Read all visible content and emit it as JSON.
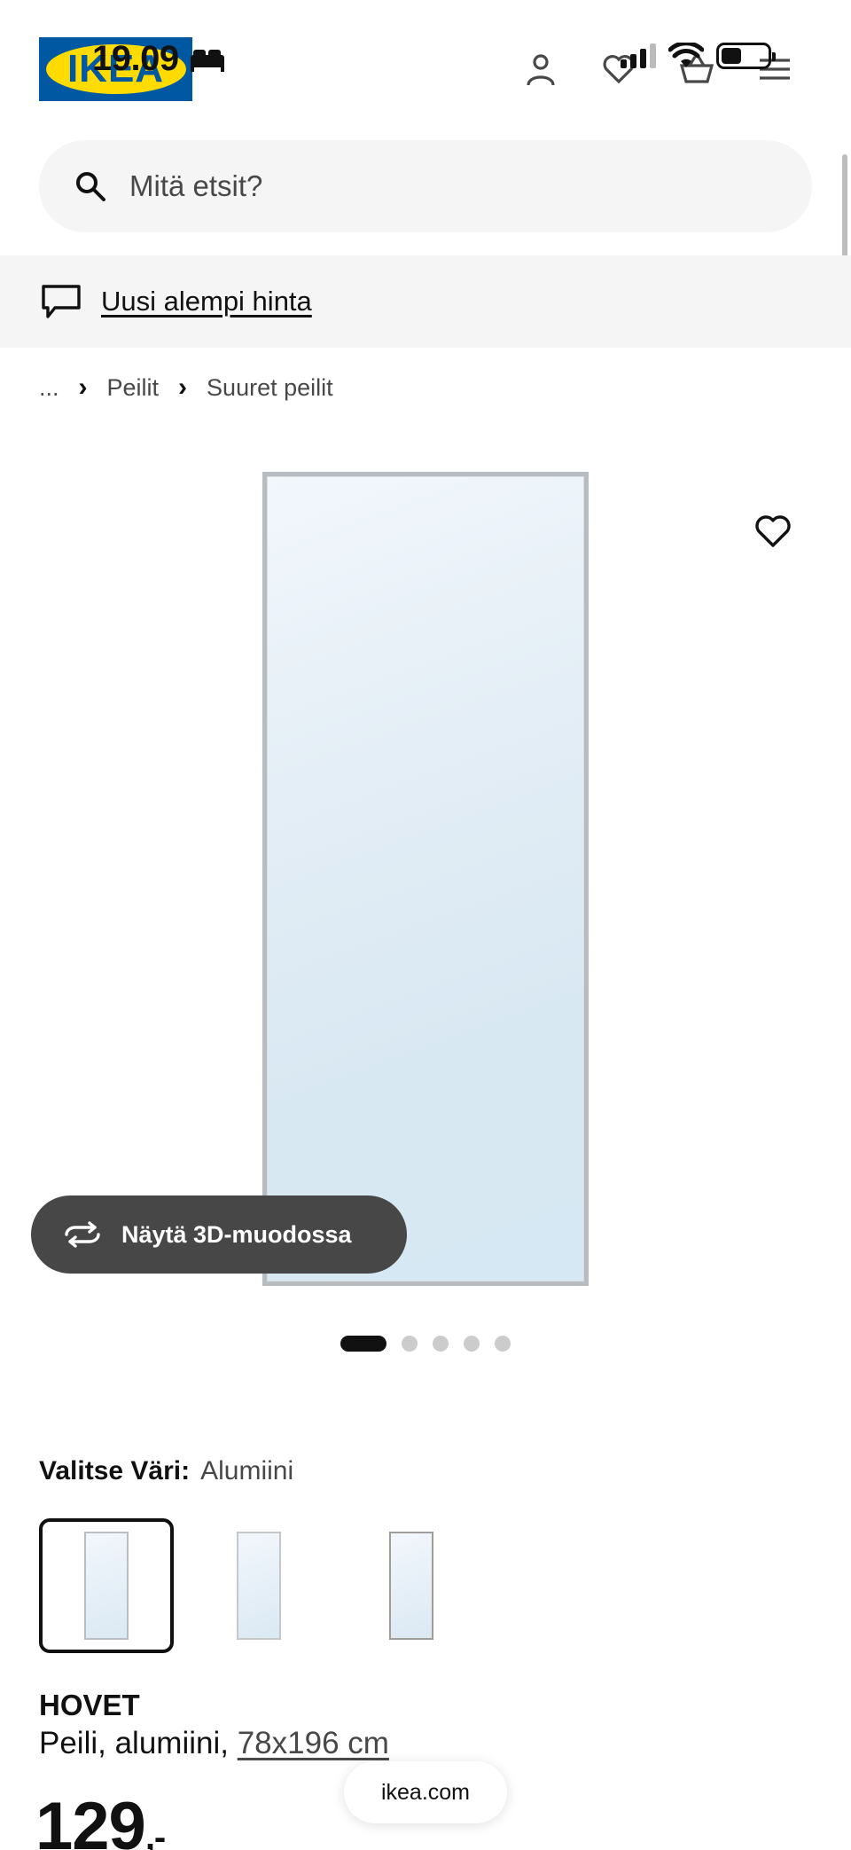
{
  "status_bar": {
    "time": "19.09"
  },
  "header": {
    "logo_text": "IKEA",
    "brand_colors": {
      "blue": "#0058a3",
      "yellow": "#ffdb00"
    },
    "icons": [
      "profile-icon",
      "heart-icon",
      "cart-icon",
      "menu-icon"
    ]
  },
  "search": {
    "placeholder": "Mitä etsit?"
  },
  "promo": {
    "label": "Uusi alempi hinta"
  },
  "breadcrumb": {
    "items": [
      "...",
      "Peilit",
      "Suuret peilit"
    ]
  },
  "gallery": {
    "view_3d_label": "Näytä 3D-muodossa",
    "dots_total": 5,
    "dots_active": 1
  },
  "color": {
    "label": "Valitse Väri:",
    "selected_value": "Alumiini",
    "options": [
      "Alumiini",
      "Valkoinen",
      "Musta"
    ]
  },
  "product": {
    "name": "HOVET",
    "description": "Peili, alumiini,",
    "dimensions": "78x196 cm",
    "price": "129",
    "price_suffix": ",-"
  },
  "browser": {
    "url": "ikea.com"
  }
}
